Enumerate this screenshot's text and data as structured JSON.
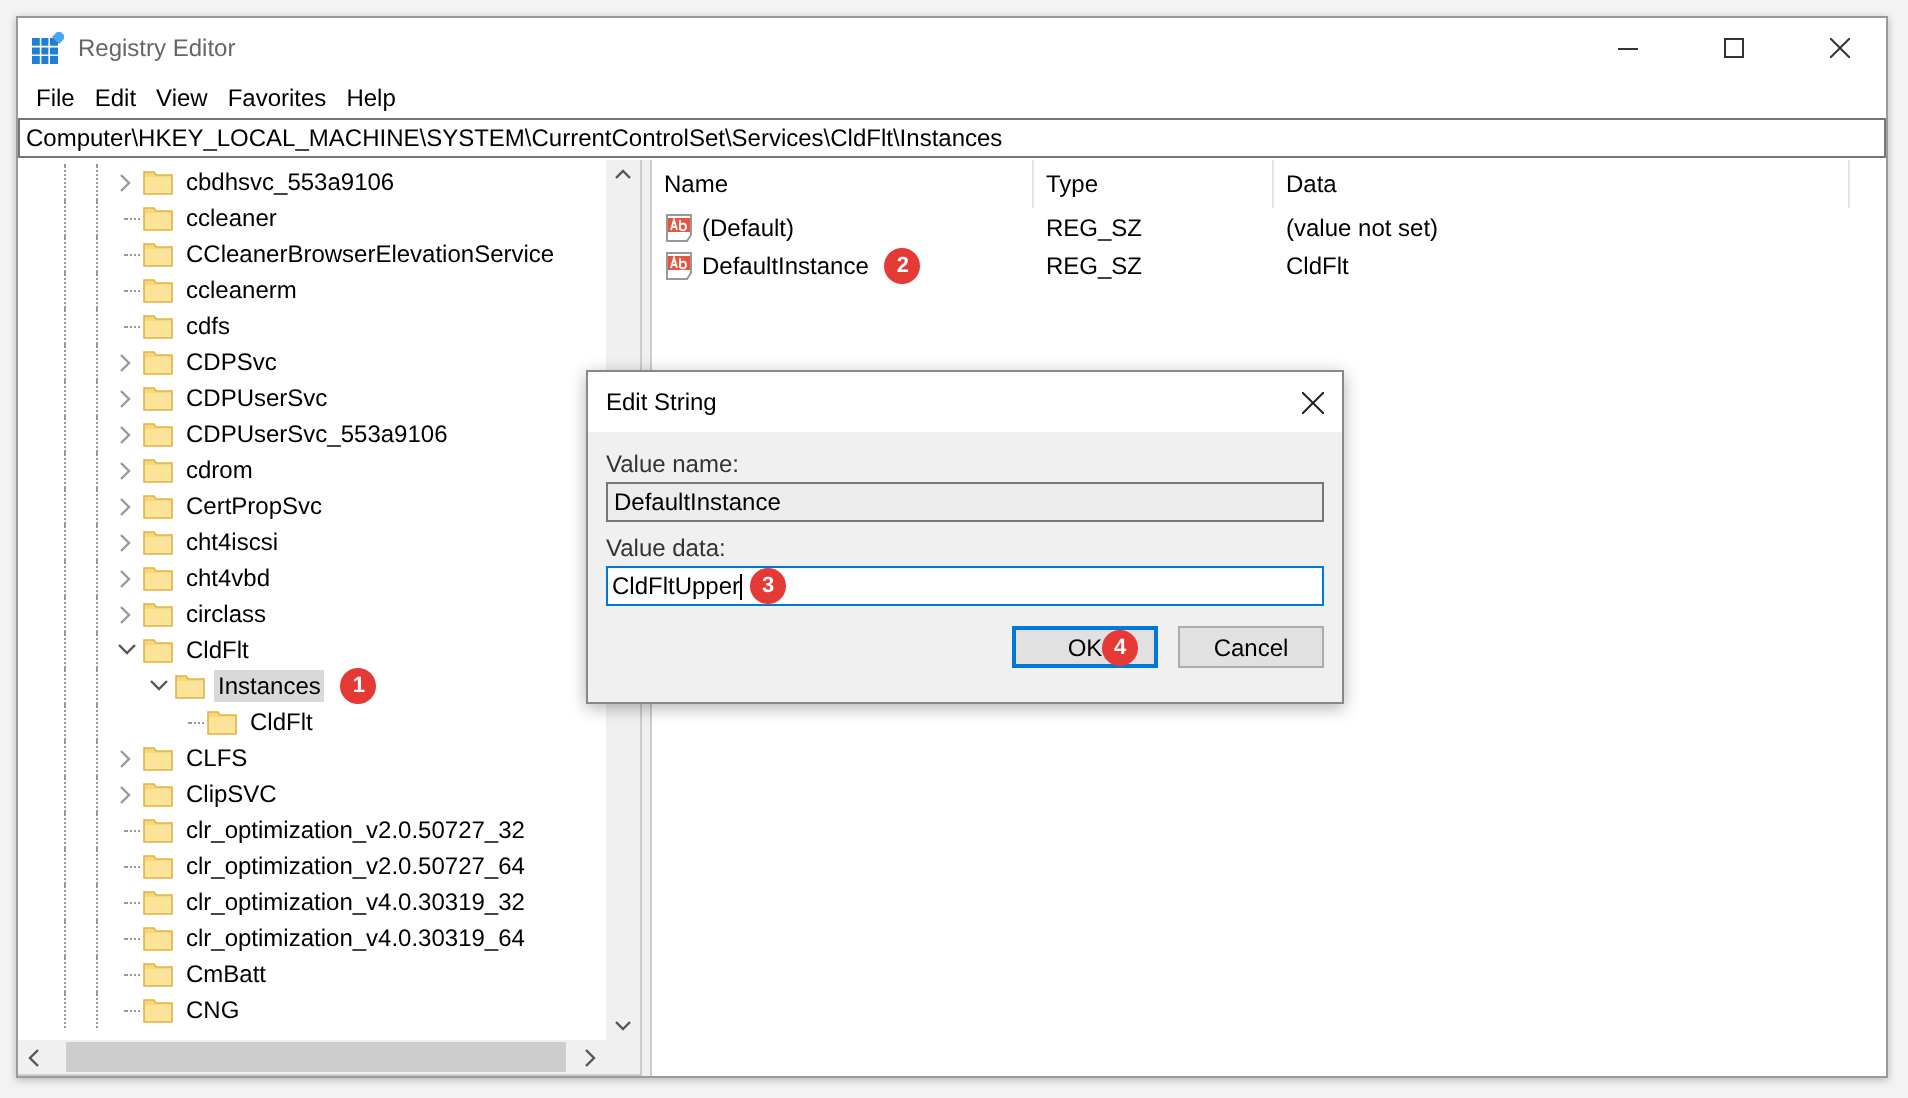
{
  "window": {
    "title": "Registry Editor"
  },
  "menu": [
    "File",
    "Edit",
    "View",
    "Favorites",
    "Help"
  ],
  "address": "Computer\\HKEY_LOCAL_MACHINE\\SYSTEM\\CurrentControlSet\\Services\\CldFlt\\Instances",
  "tree": [
    {
      "label": "cbdhsvc_553a9106",
      "kind": "branch",
      "expanded": false,
      "selected": false
    },
    {
      "label": "ccleaner",
      "kind": "leaf",
      "selected": false
    },
    {
      "label": "CCleanerBrowserElevationService",
      "kind": "leaf",
      "selected": false
    },
    {
      "label": "ccleanerm",
      "kind": "leaf",
      "selected": false
    },
    {
      "label": "cdfs",
      "kind": "leaf",
      "selected": false
    },
    {
      "label": "CDPSvc",
      "kind": "branch",
      "expanded": false,
      "selected": false
    },
    {
      "label": "CDPUserSvc",
      "kind": "branch",
      "expanded": false,
      "selected": false
    },
    {
      "label": "CDPUserSvc_553a9106",
      "kind": "branch",
      "expanded": false,
      "selected": false
    },
    {
      "label": "cdrom",
      "kind": "branch",
      "expanded": false,
      "selected": false
    },
    {
      "label": "CertPropSvc",
      "kind": "branch",
      "expanded": false,
      "selected": false
    },
    {
      "label": "cht4iscsi",
      "kind": "branch",
      "expanded": false,
      "selected": false
    },
    {
      "label": "cht4vbd",
      "kind": "branch",
      "expanded": false,
      "selected": false
    },
    {
      "label": "circlass",
      "kind": "branch",
      "expanded": false,
      "selected": false
    },
    {
      "label": "CldFlt",
      "kind": "branch",
      "expanded": true,
      "selected": false,
      "children": [
        {
          "label": "Instances",
          "kind": "branch",
          "expanded": true,
          "selected": true,
          "badge": "1",
          "children": [
            {
              "label": "CldFlt",
              "kind": "leaf",
              "selected": false
            }
          ]
        }
      ]
    },
    {
      "label": "CLFS",
      "kind": "branch",
      "expanded": false,
      "selected": false
    },
    {
      "label": "ClipSVC",
      "kind": "branch",
      "expanded": false,
      "selected": false
    },
    {
      "label": "clr_optimization_v2.0.50727_32",
      "kind": "leaf",
      "selected": false
    },
    {
      "label": "clr_optimization_v2.0.50727_64",
      "kind": "leaf",
      "selected": false
    },
    {
      "label": "clr_optimization_v4.0.30319_32",
      "kind": "leaf",
      "selected": false
    },
    {
      "label": "clr_optimization_v4.0.30319_64",
      "kind": "leaf",
      "selected": false
    },
    {
      "label": "CmBatt",
      "kind": "leaf",
      "selected": false
    },
    {
      "label": "CNG",
      "kind": "leaf",
      "selected": false
    }
  ],
  "values": {
    "columns": [
      "Name",
      "Type",
      "Data"
    ],
    "rows": [
      {
        "name": "(Default)",
        "type": "REG_SZ",
        "data": "(value not set)"
      },
      {
        "name": "DefaultInstance",
        "type": "REG_SZ",
        "data": "CldFlt",
        "badge": "2"
      }
    ]
  },
  "dialog": {
    "title": "Edit String",
    "name_label": "Value name:",
    "name_value": "DefaultInstance",
    "data_label": "Value data:",
    "data_value": "CldFltUpper",
    "data_badge": "3",
    "buttons": [
      {
        "label": "OK",
        "default": true,
        "badge": "4"
      },
      {
        "label": "Cancel",
        "default": false
      }
    ]
  }
}
